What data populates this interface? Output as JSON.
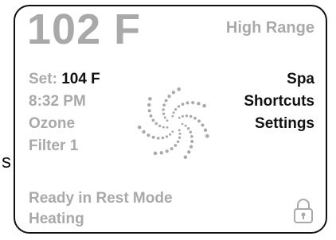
{
  "edge_fragment": "s",
  "status": {
    "temperature": "102 F",
    "range": "High Range"
  },
  "info": {
    "set_label": "Set:",
    "set_value": "104 F",
    "time": "8:32 PM",
    "ozone": "Ozone",
    "filter": "Filter 1",
    "mode": "Ready in Rest Mode",
    "heating": "Heating"
  },
  "menu": {
    "items": [
      "Spa",
      "Shortcuts",
      "Settings"
    ]
  },
  "icons": {
    "center": "swirl-icon",
    "lock": "lock-icon"
  },
  "colors": {
    "active_text": "#111111",
    "inactive_text": "#a9a9a9",
    "border": "#111111"
  }
}
